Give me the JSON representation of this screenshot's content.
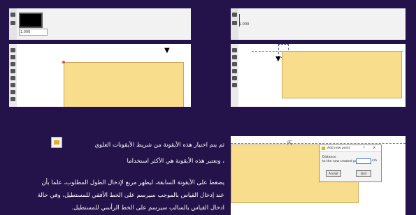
{
  "panel1": {
    "field_value": "1.000"
  },
  "panel2": {
    "field_value": "1.000"
  },
  "dialog": {
    "title": "Add new point",
    "help": "?",
    "close": "X",
    "label1": "Distance",
    "label2": "to the new created point",
    "unit": "cm",
    "accept": "Accept",
    "quit": "Quit"
  },
  "text": {
    "line1": "ثم يتم اختيار هذه الأيقونة من شريط الأيقونات العلوي",
    "line2": "، وتعتبر هذه الأيقونة هي الأكثر استخداما",
    "line3": "يضغط على الأيقونة السابقة، ليظهر مربع لإدخال الطول المطلوب، علما بأن",
    "line4": "عند إدخال القياس بالموجب سيرسم على الخط الأفقي للمستطيل، وفي حالة",
    "line5": "ادخال القياس بالسالب سيرسم على الخط الرأسي للمستطيل."
  },
  "colors": {
    "background": "#23134a",
    "shape_fill": "#f8dd8c",
    "accent_red": "#d9534f"
  }
}
